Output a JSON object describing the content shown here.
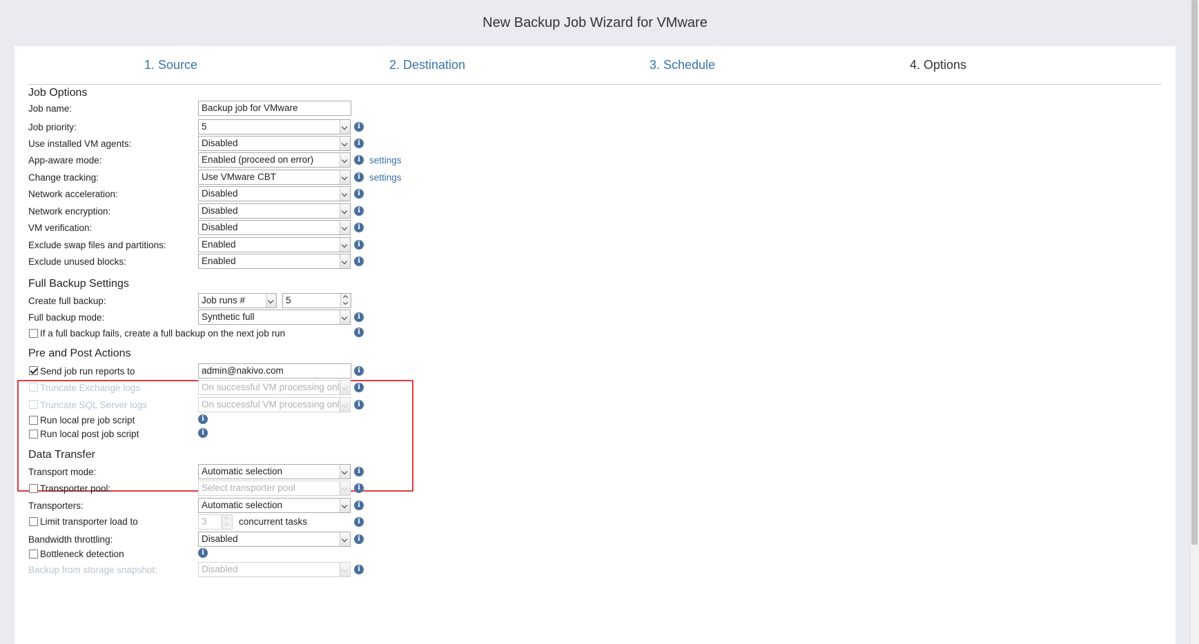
{
  "window": {
    "title": "New Backup Job Wizard for VMware"
  },
  "steps": [
    {
      "label": "1. Source"
    },
    {
      "label": "2. Destination"
    },
    {
      "label": "3. Schedule"
    },
    {
      "label": "4. Options"
    }
  ],
  "job_options": {
    "title": "Job Options",
    "job_name": {
      "label": "Job name:",
      "value": "Backup job for VMware"
    },
    "job_priority": {
      "label": "Job priority:",
      "value": "5"
    },
    "vm_agents": {
      "label": "Use installed VM agents:",
      "value": "Disabled"
    },
    "app_aware": {
      "label": "App-aware mode:",
      "value": "Enabled (proceed on error)",
      "link": "settings"
    },
    "change_tracking": {
      "label": "Change tracking:",
      "value": "Use VMware CBT",
      "link": "settings"
    },
    "net_accel": {
      "label": "Network acceleration:",
      "value": "Disabled"
    },
    "net_encrypt": {
      "label": "Network encryption:",
      "value": "Disabled"
    },
    "vm_verify": {
      "label": "VM verification:",
      "value": "Disabled"
    },
    "exclude_swap": {
      "label": "Exclude swap files and partitions:",
      "value": "Enabled"
    },
    "exclude_unused": {
      "label": "Exclude unused blocks:",
      "value": "Enabled"
    }
  },
  "full_backup": {
    "title": "Full Backup Settings",
    "create": {
      "label": "Create full backup:",
      "value": "Job runs #",
      "number": "5"
    },
    "mode": {
      "label": "Full backup mode:",
      "value": "Synthetic full"
    },
    "on_fail": {
      "label": "If a full backup fails, create a full backup on the next job run",
      "checked": false
    }
  },
  "pre_post": {
    "title": "Pre and Post Actions",
    "send_reports": {
      "label": "Send job run reports to",
      "value": "admin@nakivo.com",
      "checked": true
    },
    "truncate_exchange": {
      "label": "Truncate Exchange logs",
      "value": "On successful VM processing only"
    },
    "truncate_sql": {
      "label": "Truncate SQL Server logs",
      "value": "On successful VM processing only"
    },
    "pre_script": {
      "label": "Run local pre job script"
    },
    "post_script": {
      "label": "Run local post job script"
    }
  },
  "data_transfer": {
    "title": "Data Transfer",
    "transport_mode": {
      "label": "Transport mode:",
      "value": "Automatic selection"
    },
    "transporter_pool": {
      "label": "Transporter pool:",
      "placeholder": "Select transporter pool"
    },
    "transporters": {
      "label": "Transporters:",
      "value": "Automatic selection"
    },
    "limit_load": {
      "label": "Limit transporter load to",
      "value": "3",
      "suffix": "concurrent tasks"
    },
    "bandwidth": {
      "label": "Bandwidth throttling:",
      "value": "Disabled"
    },
    "bottleneck": {
      "label": "Bottleneck detection"
    },
    "storage_snapshot": {
      "label": "Backup from storage snapshot:",
      "value": "Disabled"
    }
  },
  "icons": {
    "info": "i"
  },
  "colors": {
    "accent": "#3a72a8",
    "highlight_box": "#e0393e",
    "info_icon": "#4a6f9c"
  }
}
